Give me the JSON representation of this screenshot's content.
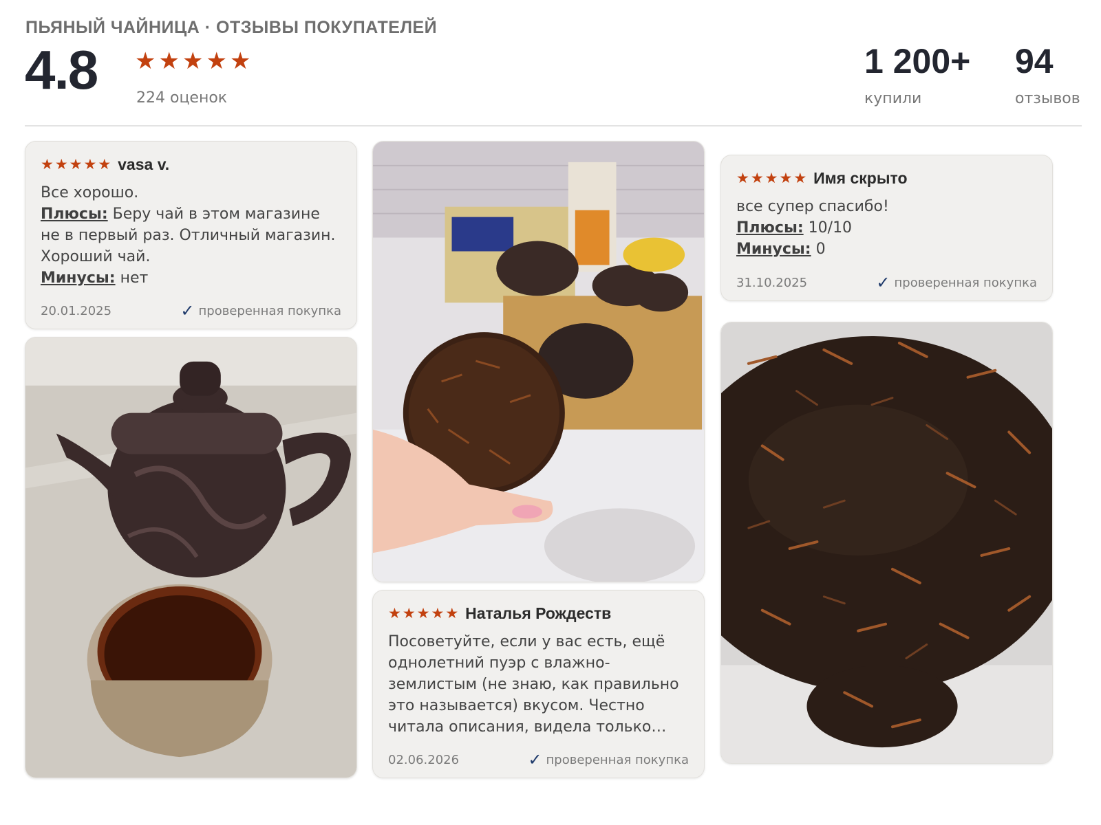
{
  "header": {
    "shop_title": "ПЬЯНЫЙ ЧАЙНИЦА · ОТЗЫВЫ ПОКУПАТЕЛЕЙ",
    "rating": "4.8",
    "stars": 5,
    "ratings_count": "224 оценок",
    "bought_count": "1 200+",
    "bought_label": "купили",
    "reviews_count": "94",
    "reviews_label": "отзывов"
  },
  "colors": {
    "star": "#c2410f",
    "check": "#1f3a6b",
    "card_bg": "#f1f0ee"
  },
  "reviews": [
    {
      "author": "vasa v.",
      "stars": 5,
      "text": "Все хорошо.",
      "pros_label": "Плюсы:",
      "pros": "Беру чай в этом магазине не в первый раз. Отличный магазин. Хороший чай.",
      "cons_label": "Минусы:",
      "cons": "нет",
      "date": "20.01.2025",
      "verified": "проверенная покупка"
    },
    {
      "author": "Наталья Рождеств",
      "stars": 5,
      "text": "Посоветуйте, если у вас есть, ещё однолетний пуэр с влажно-землистым (не знаю, как правильно это называется) вкусом. Честно читала описания, видела только…",
      "date": "02.06.2026",
      "verified": "проверенная покупка"
    },
    {
      "author": "Имя скрыто",
      "stars": 5,
      "text": "все супер спасибо!",
      "pros_label": "Плюсы:",
      "pros": "10/10",
      "cons_label": "Минусы:",
      "cons": "0",
      "date": "31.10.2025",
      "verified": "проверенная покупка"
    }
  ],
  "icons": {
    "star": "star-icon",
    "check": "checkmark-icon"
  }
}
